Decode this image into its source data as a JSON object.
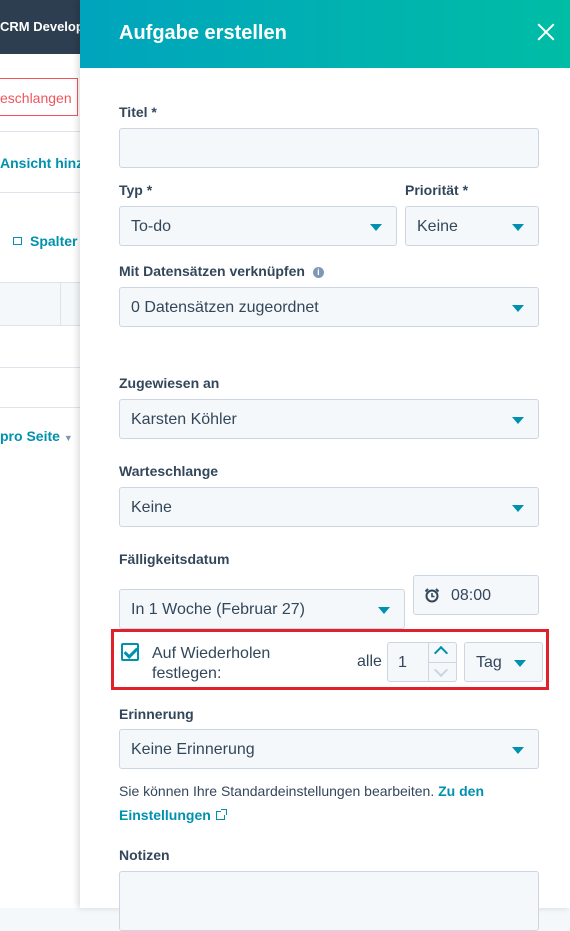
{
  "background": {
    "topbar_text": "CRM Develop",
    "tab_label": "eschlangen",
    "add_view_link": "Ansicht hinz",
    "columns_link": "Spalter",
    "per_page_link": "pro Seite"
  },
  "panel": {
    "title": "Aufgabe erstellen",
    "close_label": "×"
  },
  "form": {
    "title_label": "Titel *",
    "title_value": "",
    "type_label": "Typ *",
    "type_value": "To-do",
    "priority_label": "Priorität *",
    "priority_value": "Keine",
    "link_label": "Mit Datensätzen verknüpfen",
    "link_info_icon": "info-icon",
    "link_value": "0 Datensätzen zugeordnet",
    "assigned_label": "Zugewiesen an",
    "assigned_value": "Karsten Köhler",
    "queue_label": "Warteschlange",
    "queue_value": "Keine",
    "due_label": "Fälligkeitsdatum",
    "due_value": "In 1 Woche (Februar 27)",
    "time_value": "08:00",
    "repeat_label": "Auf Wiederholen festlegen:",
    "repeat_checked": true,
    "every_label": "alle",
    "repeat_count": "1",
    "repeat_unit": "Tag",
    "reminder_label": "Erinnerung",
    "reminder_value": "Keine Erinnerung",
    "help_text": "Sie können Ihre Standardeinstellungen bearbeiten.",
    "settings_link": "Zu den Einstellungen",
    "notes_label": "Notizen"
  },
  "colors": {
    "accent": "#0091ae",
    "header_gradient_start": "#00a4bd",
    "header_gradient_end": "#00bda5",
    "highlight": "#e0212c"
  }
}
